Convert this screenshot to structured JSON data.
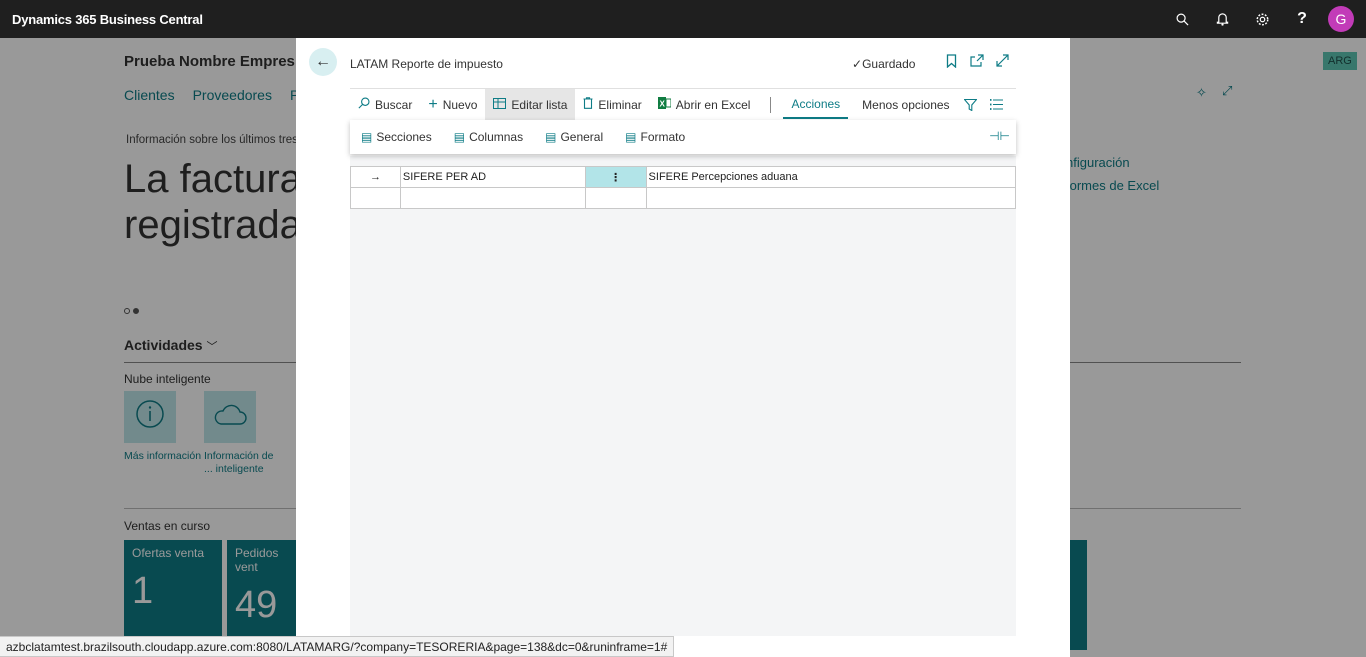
{
  "app": {
    "title": "Dynamics 365 Business Central",
    "avatar_initial": "G",
    "icons": [
      "search-icon",
      "bell-icon",
      "gear-icon",
      "help-icon"
    ]
  },
  "background": {
    "company": "Prueba Nombre Empres",
    "nav": [
      "Clientes",
      "Proveedores",
      "Pro"
    ],
    "info_text": "Información sobre los últimos tres",
    "headline_line1": "La factura",
    "headline_line2": "registrada",
    "activities": "Actividades",
    "section_nube": "Nube inteligente",
    "tiles": [
      {
        "label": "Más información"
      },
      {
        "label": "Información de ... inteligente"
      }
    ],
    "ventas": "Ventas en curso",
    "cues": [
      {
        "title": "Ofertas venta",
        "value": "1"
      },
      {
        "title": "Pedidos vent",
        "value": "49"
      }
    ],
    "right_links": [
      "nfiguración",
      "formes de Excel"
    ],
    "badge": "ARG"
  },
  "dialog": {
    "title": "LATAM Reporte de impuesto",
    "saved": "Guardado",
    "actions": {
      "search": "Buscar",
      "new": "Nuevo",
      "edit_list": "Editar lista",
      "delete": "Eliminar",
      "open_excel": "Abrir en Excel",
      "actions_tab": "Acciones",
      "fewer_options": "Menos opciones"
    },
    "submenu": [
      "Secciones",
      "Columnas",
      "General",
      "Formato"
    ],
    "rows": [
      {
        "code": "SIFERE PER AD",
        "description": "SIFERE Percepciones aduana"
      },
      {
        "code": "",
        "description": ""
      }
    ]
  },
  "status_url": "azbclatamtest.brazilsouth.cloudapp.azure.com:8080/LATAMARG/?company=TESORERIA&page=138&dc=0&runinframe=1#"
}
